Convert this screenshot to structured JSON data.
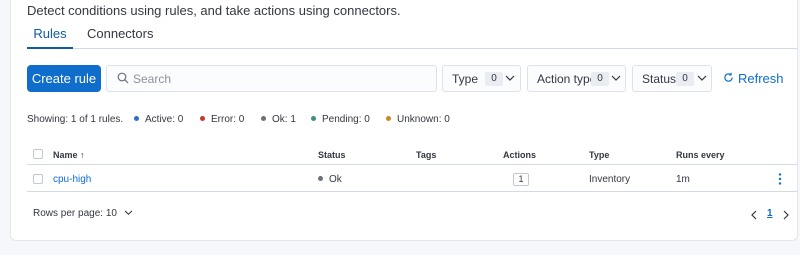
{
  "description": "Detect conditions using rules, and take actions using connectors.",
  "tabs": [
    {
      "label": "Rules",
      "active": true
    },
    {
      "label": "Connectors",
      "active": false
    }
  ],
  "toolbar": {
    "create_label": "Create rule",
    "search_placeholder": "Search",
    "filters": [
      {
        "label": "Type",
        "count": "0"
      },
      {
        "label": "Action type",
        "count": "0"
      },
      {
        "label": "Status",
        "count": "0"
      }
    ],
    "refresh_label": "Refresh"
  },
  "summary": {
    "showing": "Showing: 1 of 1 rules.",
    "statuses": [
      {
        "label": "Active: 0",
        "color": "#2e6fc7"
      },
      {
        "label": "Error: 0",
        "color": "#c23a2b"
      },
      {
        "label": "Ok: 1",
        "color": "#6a717d"
      },
      {
        "label": "Pending: 0",
        "color": "#3d8f86"
      },
      {
        "label": "Unknown: 0",
        "color": "#c48b22"
      }
    ]
  },
  "table": {
    "headers": {
      "name": "Name",
      "sort_glyph": "↑",
      "status": "Status",
      "tags": "Tags",
      "actions": "Actions",
      "type": "Type",
      "runs_every": "Runs every"
    },
    "rows": [
      {
        "name": "cpu-high",
        "status": "Ok",
        "tags": "",
        "actions": "1",
        "type": "Inventory",
        "runs_every": "1m"
      }
    ]
  },
  "pagination": {
    "rows_per_page": "Rows per page: 10",
    "current_page": "1"
  },
  "colors": {
    "accent": "#0f6ecb",
    "tab_active": "#0f5aa8"
  }
}
